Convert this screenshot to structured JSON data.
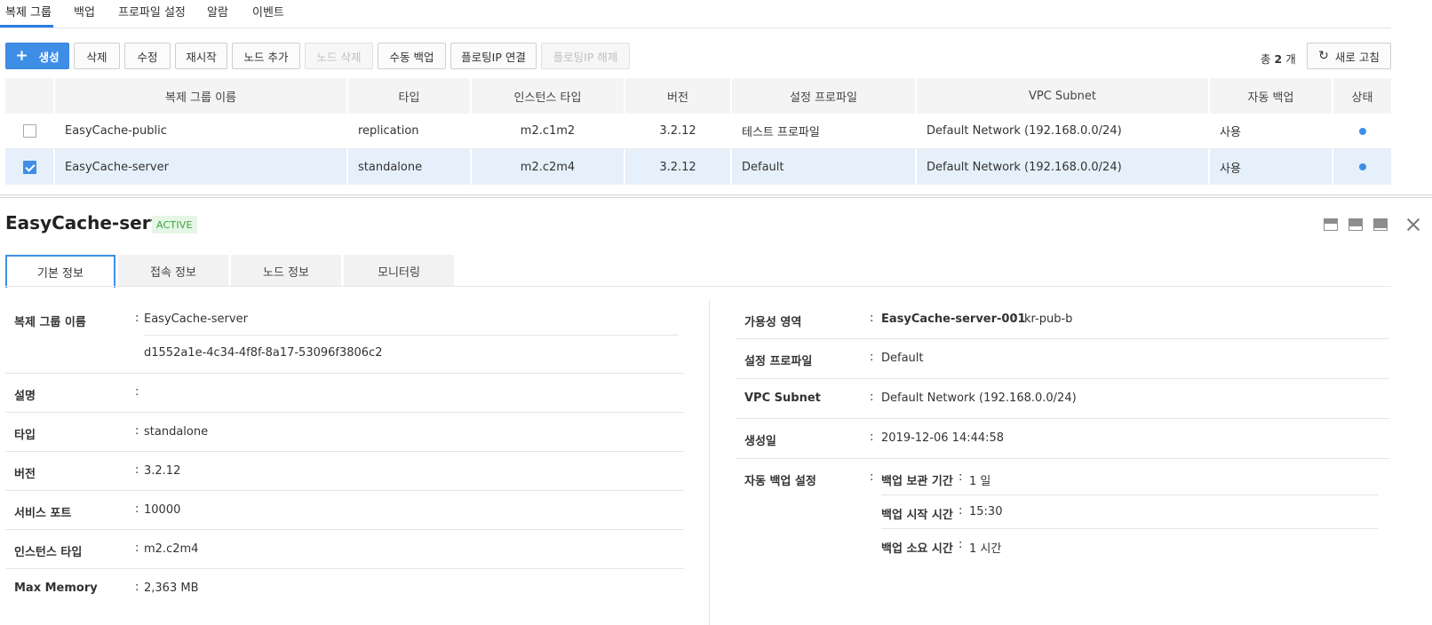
{
  "top_tabs": [
    "복제 그룹",
    "백업",
    "프로파일 설정",
    "알람",
    "이벤트"
  ],
  "toolbar": {
    "create": "생성",
    "delete": "삭제",
    "edit": "수정",
    "restart": "재시작",
    "add_node": "노드 추가",
    "delete_node": "노드 삭제",
    "manual_backup": "수동 백업",
    "attach_fip": "플로팅IP 연결",
    "detach_fip": "플로팅IP 해제",
    "total_prefix": "총",
    "total_count": "2",
    "total_suffix": "개",
    "refresh": "새로 고침"
  },
  "table": {
    "headers": [
      "복제 그룹 이름",
      "타입",
      "인스턴스 타입",
      "버전",
      "설정 프로파일",
      "VPC Subnet",
      "자동 백업",
      "상태"
    ],
    "rows": [
      {
        "name": "EasyCache-public",
        "type": "replication",
        "instance_type": "m2.c1m2",
        "version": "3.2.12",
        "profile": "테스트 프로파일",
        "subnet": "Default Network (192.168.0.0/24)",
        "auto_backup": "사용",
        "checked": false
      },
      {
        "name": "EasyCache-server",
        "type": "standalone",
        "instance_type": "m2.c2m4",
        "version": "3.2.12",
        "profile": "Default",
        "subnet": "Default Network (192.168.0.0/24)",
        "auto_backup": "사용",
        "checked": true
      }
    ]
  },
  "detail": {
    "title": "EasyCache-server",
    "status": "ACTIVE",
    "tabs": [
      "기본 정보",
      "접속 정보",
      "노드 정보",
      "모니터링"
    ],
    "left": {
      "group_name_label": "복제 그룹 이름",
      "group_name": "EasyCache-server",
      "group_id": "d1552a1e-4c34-4f8f-8a17-53096f3806c2",
      "desc_label": "설명",
      "desc": "",
      "type_label": "타입",
      "type": "standalone",
      "version_label": "버전",
      "version": "3.2.12",
      "port_label": "서비스 포트",
      "port": "10000",
      "instance_label": "인스턴스 타입",
      "instance": "m2.c2m4",
      "memory_label": "Max Memory",
      "memory": "2,363 MB"
    },
    "right": {
      "az_label": "가용성 영역",
      "az_node": "EasyCache-server-001",
      "az_value": "kr-pub-b",
      "profile_label": "설정 프로파일",
      "profile": "Default",
      "subnet_label": "VPC Subnet",
      "subnet": "Default Network (192.168.0.0/24)",
      "created_label": "생성일",
      "created": "2019-12-06 14:44:58",
      "backup_label": "자동 백업 설정",
      "retention_label": "백업 보관 기간",
      "retention": "1 일",
      "start_label": "백업 시작 시간",
      "start": "15:30",
      "duration_label": "백업 소요 시간",
      "duration": "1 시간"
    }
  },
  "colors": {
    "accent": "#3f8ee6",
    "active_badge_bg": "#e6f6e6",
    "active_badge_text": "#3ca13c",
    "selected_row": "#e6f0fb"
  }
}
